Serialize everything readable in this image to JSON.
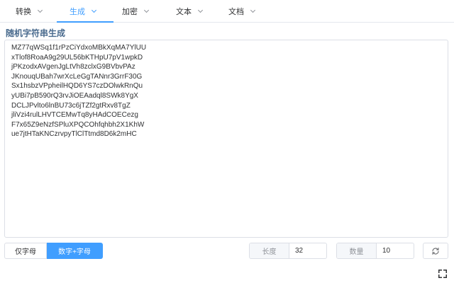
{
  "nav": {
    "tabs": [
      {
        "label": "转换"
      },
      {
        "label": "生成"
      },
      {
        "label": "加密"
      },
      {
        "label": "文本"
      },
      {
        "label": "文档"
      }
    ],
    "active_index": 1
  },
  "page": {
    "title": "随机字符串生成"
  },
  "output": {
    "lines": [
      "MZ77qWSq1f1rPzCiYdxoMBkXqMA7YlUU",
      "xTlof8RoaA9g29UL56bKTHpU7pV1wpkD",
      "jPKzodxAVgenJgLtVh8zclxG9BVbvPAz",
      "JKnouqUBah7wrXcLeGgTANnr3GrrF30G",
      "Sx1hsbzVPpheilHQD6YS7czDOlwkRnQu",
      "yUBi7pB590rQ3rvJiOEAadql8SWk8YgX",
      "DCLJPvlto6lnBU73c6jTZf2gtRxv8TgZ",
      "jliVzi4rulLHVTCEMwTq8yHAdCOECezg",
      "F7x65Z9eNzfSPluXPQCOhfqhbh2X1KhW",
      "ue7jtHTaKNCzrvpyTlClTtmd8D6k2mHC"
    ]
  },
  "controls": {
    "letters_only_label": "仅字母",
    "alnum_label": "数字+字母",
    "length_label": "长度",
    "length_value": "32",
    "count_label": "数量",
    "count_value": "10",
    "refresh_icon": "refresh-icon",
    "fullscreen_icon": "fullscreen-icon"
  },
  "colors": {
    "accent": "#409eff",
    "title": "#4a6b8e",
    "border": "#dcdfe6"
  }
}
